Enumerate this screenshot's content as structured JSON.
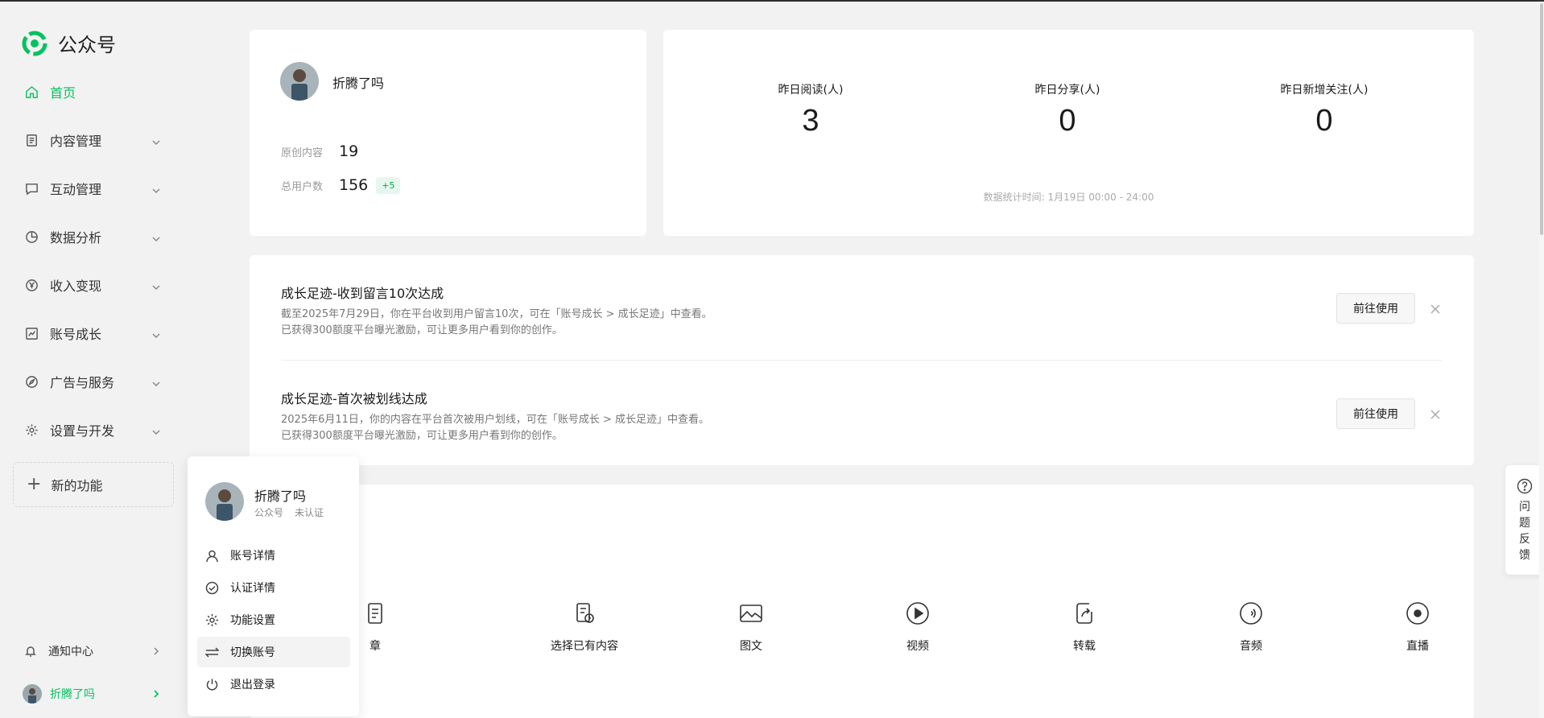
{
  "app": {
    "title": "公众号",
    "brand_color": "#07c160"
  },
  "sidebar": {
    "items": [
      {
        "label": "首页",
        "icon": "home-icon",
        "active": true
      },
      {
        "label": "内容管理",
        "icon": "document-icon"
      },
      {
        "label": "互动管理",
        "icon": "chat-icon"
      },
      {
        "label": "数据分析",
        "icon": "pie-chart-icon"
      },
      {
        "label": "收入变现",
        "icon": "yen-icon"
      },
      {
        "label": "账号成长",
        "icon": "trend-chart-icon"
      },
      {
        "label": "广告与服务",
        "icon": "compass-icon"
      },
      {
        "label": "设置与开发",
        "icon": "gear-icon"
      }
    ],
    "new_feature": "新的功能",
    "notify": "通知中心",
    "me": "折腾了吗"
  },
  "profile": {
    "name": "折腾了吗",
    "original_label": "原创内容",
    "original_value": "19",
    "users_label": "总用户数",
    "users_value": "156",
    "users_delta": "+5"
  },
  "stats": {
    "items": [
      {
        "label": "昨日阅读(人)",
        "value": "3"
      },
      {
        "label": "昨日分享(人)",
        "value": "0"
      },
      {
        "label": "昨日新增关注(人)",
        "value": "0"
      }
    ],
    "footer": "数据统计时间: 1月19日 00:00 - 24:00"
  },
  "growth": {
    "items": [
      {
        "title": "成长足迹-收到留言10次达成",
        "line1": "截至2025年7月29日，你在平台收到用户留言10次，可在「账号成长 > 成长足迹」中查看。",
        "line2": "已获得300额度平台曝光激励，可让更多用户看到你的创作。",
        "button": "前往使用"
      },
      {
        "title": "成长足迹-首次被划线达成",
        "line1": "2025年6月11日，你的内容在平台首次被用户划线，可在「账号成长 > 成长足迹」中查看。",
        "line2": "已获得300额度平台曝光激励，可让更多用户看到你的创作。",
        "button": "前往使用"
      }
    ]
  },
  "create": {
    "items": [
      {
        "label": "章",
        "icon": "article-icon"
      },
      {
        "label": "选择已有内容",
        "icon": "select-content-icon"
      },
      {
        "label": "图文",
        "icon": "image-text-icon"
      },
      {
        "label": "视频",
        "icon": "video-icon"
      },
      {
        "label": "转载",
        "icon": "repost-icon"
      },
      {
        "label": "音频",
        "icon": "audio-icon"
      },
      {
        "label": "直播",
        "icon": "live-icon"
      }
    ]
  },
  "popover": {
    "name": "折腾了吗",
    "type": "公众号",
    "status": "未认证",
    "items": [
      {
        "label": "账号详情",
        "icon": "user-icon"
      },
      {
        "label": "认证详情",
        "icon": "check-circle-icon"
      },
      {
        "label": "功能设置",
        "icon": "gear-icon"
      },
      {
        "label": "切换账号",
        "icon": "switch-icon"
      },
      {
        "label": "退出登录",
        "icon": "power-icon"
      }
    ]
  },
  "feedback": {
    "label": "问题反馈",
    "icon": "question-icon"
  }
}
